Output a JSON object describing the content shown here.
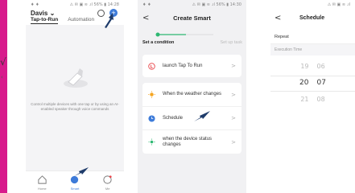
{
  "left_margin": {
    "check": "√",
    "arrow": "‹"
  },
  "phone1": {
    "status": {
      "left": "♦ ♦",
      "right": "⚠ ✉ ▣ ≋ .ıl 56% ▮ 14:28"
    },
    "home_title": "Davis ⌄",
    "tabs": [
      "Tap-to-Run",
      "Automation"
    ],
    "empty_text": "Control multiple devices with one tap or by using an AI-enabled speaker through voice commands",
    "nav": [
      {
        "label": "Home",
        "icon": "home-icon"
      },
      {
        "label": "Smart",
        "icon": "smart-icon"
      },
      {
        "label": "Me",
        "icon": "profile-icon"
      }
    ]
  },
  "phone2": {
    "status": {
      "left": "♦ ♦",
      "right": "⚠ ✉ ▣ ≋ .ıl 56% ▮ 14:30"
    },
    "title": "Create Smart",
    "back": "<",
    "steps": [
      "Set a condition",
      "Set up task"
    ],
    "launch_label": "launch Tap To Run",
    "conditions": [
      {
        "label": "When the weather changes",
        "icon": "sun-icon"
      },
      {
        "label": "Schedule",
        "icon": "clock-icon"
      },
      {
        "label": "when the device status changes",
        "icon": "device-icon"
      }
    ],
    "chevron": ">",
    "colors": {
      "accent": "#2eb872",
      "launch": "#e8454a",
      "sun": "#f5a623",
      "clock": "#3d7bd9",
      "device": "#2eb872"
    }
  },
  "phone3": {
    "status": {
      "right": "⚠ ✉ ▣ ≋ .ıl"
    },
    "title": "Schedule",
    "back": "<",
    "repeat_label": "Repeat",
    "execution_label": "Execution Time",
    "time_rows": [
      {
        "hour": "19",
        "minute": "06"
      },
      {
        "hour": "20",
        "minute": "07"
      },
      {
        "hour": "21",
        "minute": "08"
      }
    ]
  }
}
